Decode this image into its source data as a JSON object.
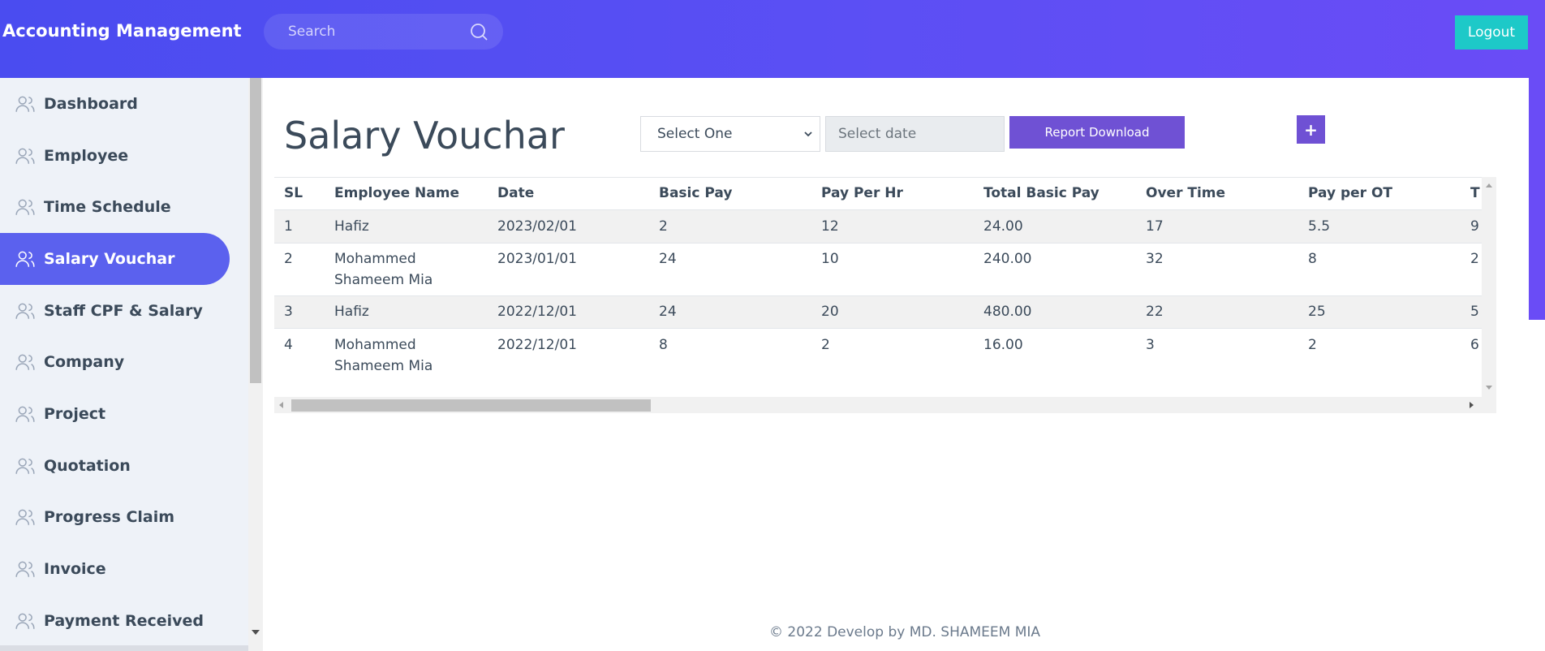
{
  "app": {
    "title": "Accounting Management"
  },
  "search": {
    "placeholder": "Search",
    "icon": "search-icon"
  },
  "header": {
    "logout_label": "Logout"
  },
  "sidebar": {
    "items": [
      {
        "label": "Dashboard",
        "icon": "user-icon"
      },
      {
        "label": "Employee",
        "icon": "user-icon"
      },
      {
        "label": "Time Schedule",
        "icon": "user-icon"
      },
      {
        "label": "Salary Vouchar",
        "icon": "user-icon",
        "active": true
      },
      {
        "label": "Staff CPF & Salary",
        "icon": "user-icon"
      },
      {
        "label": "Company",
        "icon": "user-icon"
      },
      {
        "label": "Project",
        "icon": "user-icon"
      },
      {
        "label": "Quotation",
        "icon": "user-icon"
      },
      {
        "label": "Progress Claim",
        "icon": "user-icon"
      },
      {
        "label": "Invoice",
        "icon": "user-icon"
      },
      {
        "label": "Payment Received",
        "icon": "user-icon"
      }
    ]
  },
  "main": {
    "title": "Salary Vouchar",
    "select": {
      "value": "Select One"
    },
    "date": {
      "placeholder": "Select date"
    },
    "report_label": "Report Download",
    "add_label": "+"
  },
  "table": {
    "headers": [
      "SL",
      "Employee Name",
      "Date",
      "Basic Pay",
      "Pay Per Hr",
      "Total Basic Pay",
      "Over Time",
      "Pay per OT",
      "T"
    ],
    "rows": [
      [
        "1",
        "Hafiz",
        "2023/02/01",
        "2",
        "12",
        "24.00",
        "17",
        "5.5",
        "9"
      ],
      [
        "2",
        "Mohammed Shameem Mia",
        "2023/01/01",
        "24",
        "10",
        "240.00",
        "32",
        "8",
        "2"
      ],
      [
        "3",
        "Hafiz",
        "2022/12/01",
        "24",
        "20",
        "480.00",
        "22",
        "25",
        "5"
      ],
      [
        "4",
        "Mohammed Shameem Mia",
        "2022/12/01",
        "8",
        "2",
        "16.00",
        "3",
        "2",
        "6"
      ]
    ]
  },
  "footer": {
    "text": "© 2022 Develop by MD. SHAMEEM MIA"
  },
  "colors": {
    "header_start": "#4a4cf0",
    "header_end": "#6a4cf6",
    "accent": "#6f51d4",
    "logout": "#1dc9c8",
    "active_nav": "#5b61ee"
  }
}
